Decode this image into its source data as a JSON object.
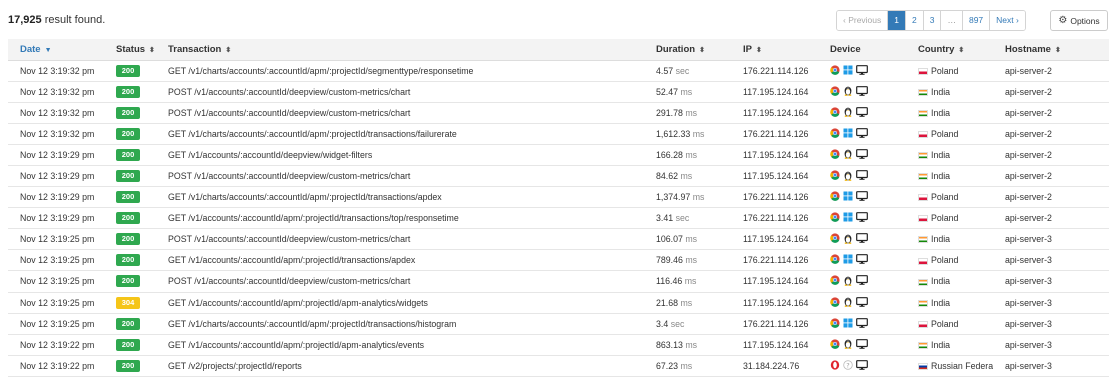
{
  "summary": {
    "count": "17,925",
    "suffix": " result found."
  },
  "pagination": {
    "prev": "‹ Previous",
    "pages": [
      "1",
      "2",
      "3",
      "…",
      "897"
    ],
    "active": "1",
    "next": "Next ›"
  },
  "options_label": "Options",
  "columns": {
    "date": "Date",
    "status": "Status",
    "transaction": "Transaction",
    "duration": "Duration",
    "ip": "IP",
    "device": "Device",
    "country": "Country",
    "hostname": "Hostname"
  },
  "colors": {
    "accent": "#337ab7",
    "status_200": "#2fa84f",
    "status_304": "#f5c518"
  },
  "rows": [
    {
      "date": "Nov 12 3:19:32 pm",
      "status": "200",
      "transaction": "GET /v1/charts/accounts/:accountId/apm/:projectId/segmenttype/responsetime",
      "duration": "4.57",
      "unit": "sec",
      "ip": "176.221.114.126",
      "browser": "chrome-icon",
      "os": "windows-icon",
      "device": "desktop-icon",
      "country": "Poland",
      "flag": "pl",
      "hostname": "api-server-2"
    },
    {
      "date": "Nov 12 3:19:32 pm",
      "status": "200",
      "transaction": "POST /v1/accounts/:accountId/deepview/custom-metrics/chart",
      "duration": "52.47",
      "unit": "ms",
      "ip": "117.195.124.164",
      "browser": "chrome-icon",
      "os": "linux-icon",
      "device": "desktop-icon",
      "country": "India",
      "flag": "in",
      "hostname": "api-server-2"
    },
    {
      "date": "Nov 12 3:19:32 pm",
      "status": "200",
      "transaction": "POST /v1/accounts/:accountId/deepview/custom-metrics/chart",
      "duration": "291.78",
      "unit": "ms",
      "ip": "117.195.124.164",
      "browser": "chrome-icon",
      "os": "linux-icon",
      "device": "desktop-icon",
      "country": "India",
      "flag": "in",
      "hostname": "api-server-2"
    },
    {
      "date": "Nov 12 3:19:32 pm",
      "status": "200",
      "transaction": "GET /v1/charts/accounts/:accountId/apm/:projectId/transactions/failurerate",
      "duration": "1,612.33",
      "unit": "ms",
      "ip": "176.221.114.126",
      "browser": "chrome-icon",
      "os": "windows-icon",
      "device": "desktop-icon",
      "country": "Poland",
      "flag": "pl",
      "hostname": "api-server-2"
    },
    {
      "date": "Nov 12 3:19:29 pm",
      "status": "200",
      "transaction": "GET /v1/accounts/:accountId/deepview/widget-filters",
      "duration": "166.28",
      "unit": "ms",
      "ip": "117.195.124.164",
      "browser": "chrome-icon",
      "os": "linux-icon",
      "device": "desktop-icon",
      "country": "India",
      "flag": "in",
      "hostname": "api-server-2"
    },
    {
      "date": "Nov 12 3:19:29 pm",
      "status": "200",
      "transaction": "POST /v1/accounts/:accountId/deepview/custom-metrics/chart",
      "duration": "84.62",
      "unit": "ms",
      "ip": "117.195.124.164",
      "browser": "chrome-icon",
      "os": "linux-icon",
      "device": "desktop-icon",
      "country": "India",
      "flag": "in",
      "hostname": "api-server-2"
    },
    {
      "date": "Nov 12 3:19:29 pm",
      "status": "200",
      "transaction": "GET /v1/charts/accounts/:accountId/apm/:projectId/transactions/apdex",
      "duration": "1,374.97",
      "unit": "ms",
      "ip": "176.221.114.126",
      "browser": "chrome-icon",
      "os": "windows-icon",
      "device": "desktop-icon",
      "country": "Poland",
      "flag": "pl",
      "hostname": "api-server-2"
    },
    {
      "date": "Nov 12 3:19:29 pm",
      "status": "200",
      "transaction": "GET /v1/accounts/:accountId/apm/:projectId/transactions/top/responsetime",
      "duration": "3.41",
      "unit": "sec",
      "ip": "176.221.114.126",
      "browser": "chrome-icon",
      "os": "windows-icon",
      "device": "desktop-icon",
      "country": "Poland",
      "flag": "pl",
      "hostname": "api-server-2"
    },
    {
      "date": "Nov 12 3:19:25 pm",
      "status": "200",
      "transaction": "POST /v1/accounts/:accountId/deepview/custom-metrics/chart",
      "duration": "106.07",
      "unit": "ms",
      "ip": "117.195.124.164",
      "browser": "chrome-icon",
      "os": "linux-icon",
      "device": "desktop-icon",
      "country": "India",
      "flag": "in",
      "hostname": "api-server-3"
    },
    {
      "date": "Nov 12 3:19:25 pm",
      "status": "200",
      "transaction": "GET /v1/accounts/:accountId/apm/:projectId/transactions/apdex",
      "duration": "789.46",
      "unit": "ms",
      "ip": "176.221.114.126",
      "browser": "chrome-icon",
      "os": "windows-icon",
      "device": "desktop-icon",
      "country": "Poland",
      "flag": "pl",
      "hostname": "api-server-3"
    },
    {
      "date": "Nov 12 3:19:25 pm",
      "status": "200",
      "transaction": "POST /v1/accounts/:accountId/deepview/custom-metrics/chart",
      "duration": "116.46",
      "unit": "ms",
      "ip": "117.195.124.164",
      "browser": "chrome-icon",
      "os": "linux-icon",
      "device": "desktop-icon",
      "country": "India",
      "flag": "in",
      "hostname": "api-server-3"
    },
    {
      "date": "Nov 12 3:19:25 pm",
      "status": "304",
      "transaction": "GET /v1/accounts/:accountId/apm/:projectId/apm-analytics/widgets",
      "duration": "21.68",
      "unit": "ms",
      "ip": "117.195.124.164",
      "browser": "chrome-icon",
      "os": "linux-icon",
      "device": "desktop-icon",
      "country": "India",
      "flag": "in",
      "hostname": "api-server-3"
    },
    {
      "date": "Nov 12 3:19:25 pm",
      "status": "200",
      "transaction": "GET /v1/charts/accounts/:accountId/apm/:projectId/transactions/histogram",
      "duration": "3.4",
      "unit": "sec",
      "ip": "176.221.114.126",
      "browser": "chrome-icon",
      "os": "windows-icon",
      "device": "desktop-icon",
      "country": "Poland",
      "flag": "pl",
      "hostname": "api-server-3"
    },
    {
      "date": "Nov 12 3:19:22 pm",
      "status": "200",
      "transaction": "GET /v1/accounts/:accountId/apm/:projectId/apm-analytics/events",
      "duration": "863.13",
      "unit": "ms",
      "ip": "117.195.124.164",
      "browser": "chrome-icon",
      "os": "linux-icon",
      "device": "desktop-icon",
      "country": "India",
      "flag": "in",
      "hostname": "api-server-3"
    },
    {
      "date": "Nov 12 3:19:22 pm",
      "status": "200",
      "transaction": "GET /v2/projects/:projectId/reports",
      "duration": "67.23",
      "unit": "ms",
      "ip": "31.184.224.76",
      "browser": "opera-icon",
      "os": "unknown-os-icon",
      "device": "desktop-icon",
      "country": "Russian Federation",
      "flag": "ru",
      "hostname": "api-server-3"
    }
  ]
}
